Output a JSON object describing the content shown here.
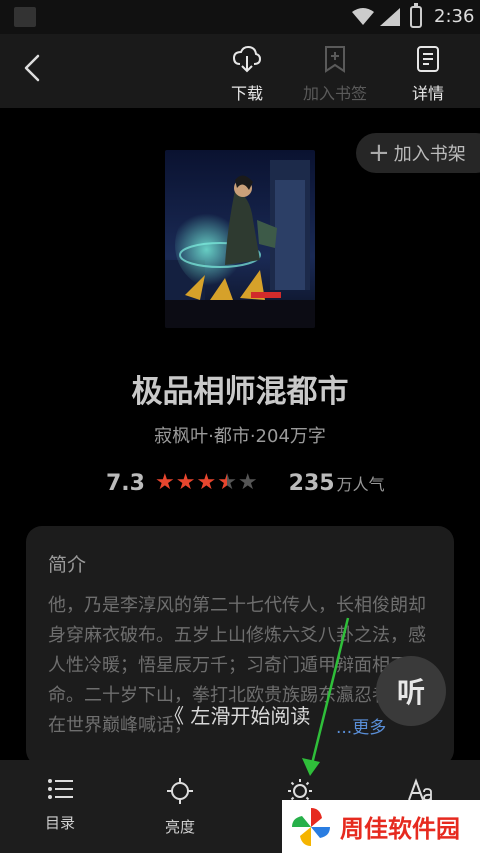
{
  "status_bar": {
    "time": "2:36"
  },
  "toolbar": {
    "download_label": "下载",
    "bookmark_label": "加入书签",
    "details_label": "详情"
  },
  "shelf_button": {
    "label": "加入书架"
  },
  "book": {
    "title": "极品相师混都市",
    "meta": "寂枫叶·都市·204万字",
    "score": "7.3",
    "stars": 3.5,
    "popularity_number": "235",
    "popularity_unit": "万人气"
  },
  "intro": {
    "heading": "简介",
    "text": "他，乃是李淳风的第二十七代传人，长相俊朗却身穿麻衣破布。五岁上山修炼六爻八卦之法，感人性冷暖；悟星辰万千；习奇门遁甲辩面相天命。二十岁下山，拳打北欧贵族踢东瀛忍者。站在世界巅峰喊话，",
    "more": "...更多"
  },
  "listen_button": {
    "label": "听"
  },
  "swipe_hint": "《 左滑开始阅读",
  "bottom_nav": {
    "toc_label": "目录",
    "brightness_label": "亮度"
  },
  "watermark": {
    "text": "周佳软件园"
  },
  "colors": {
    "star_filled": "#e8462e",
    "star_empty": "#555555",
    "link": "#5a8fd8",
    "arrow": "#2fbf3a"
  }
}
